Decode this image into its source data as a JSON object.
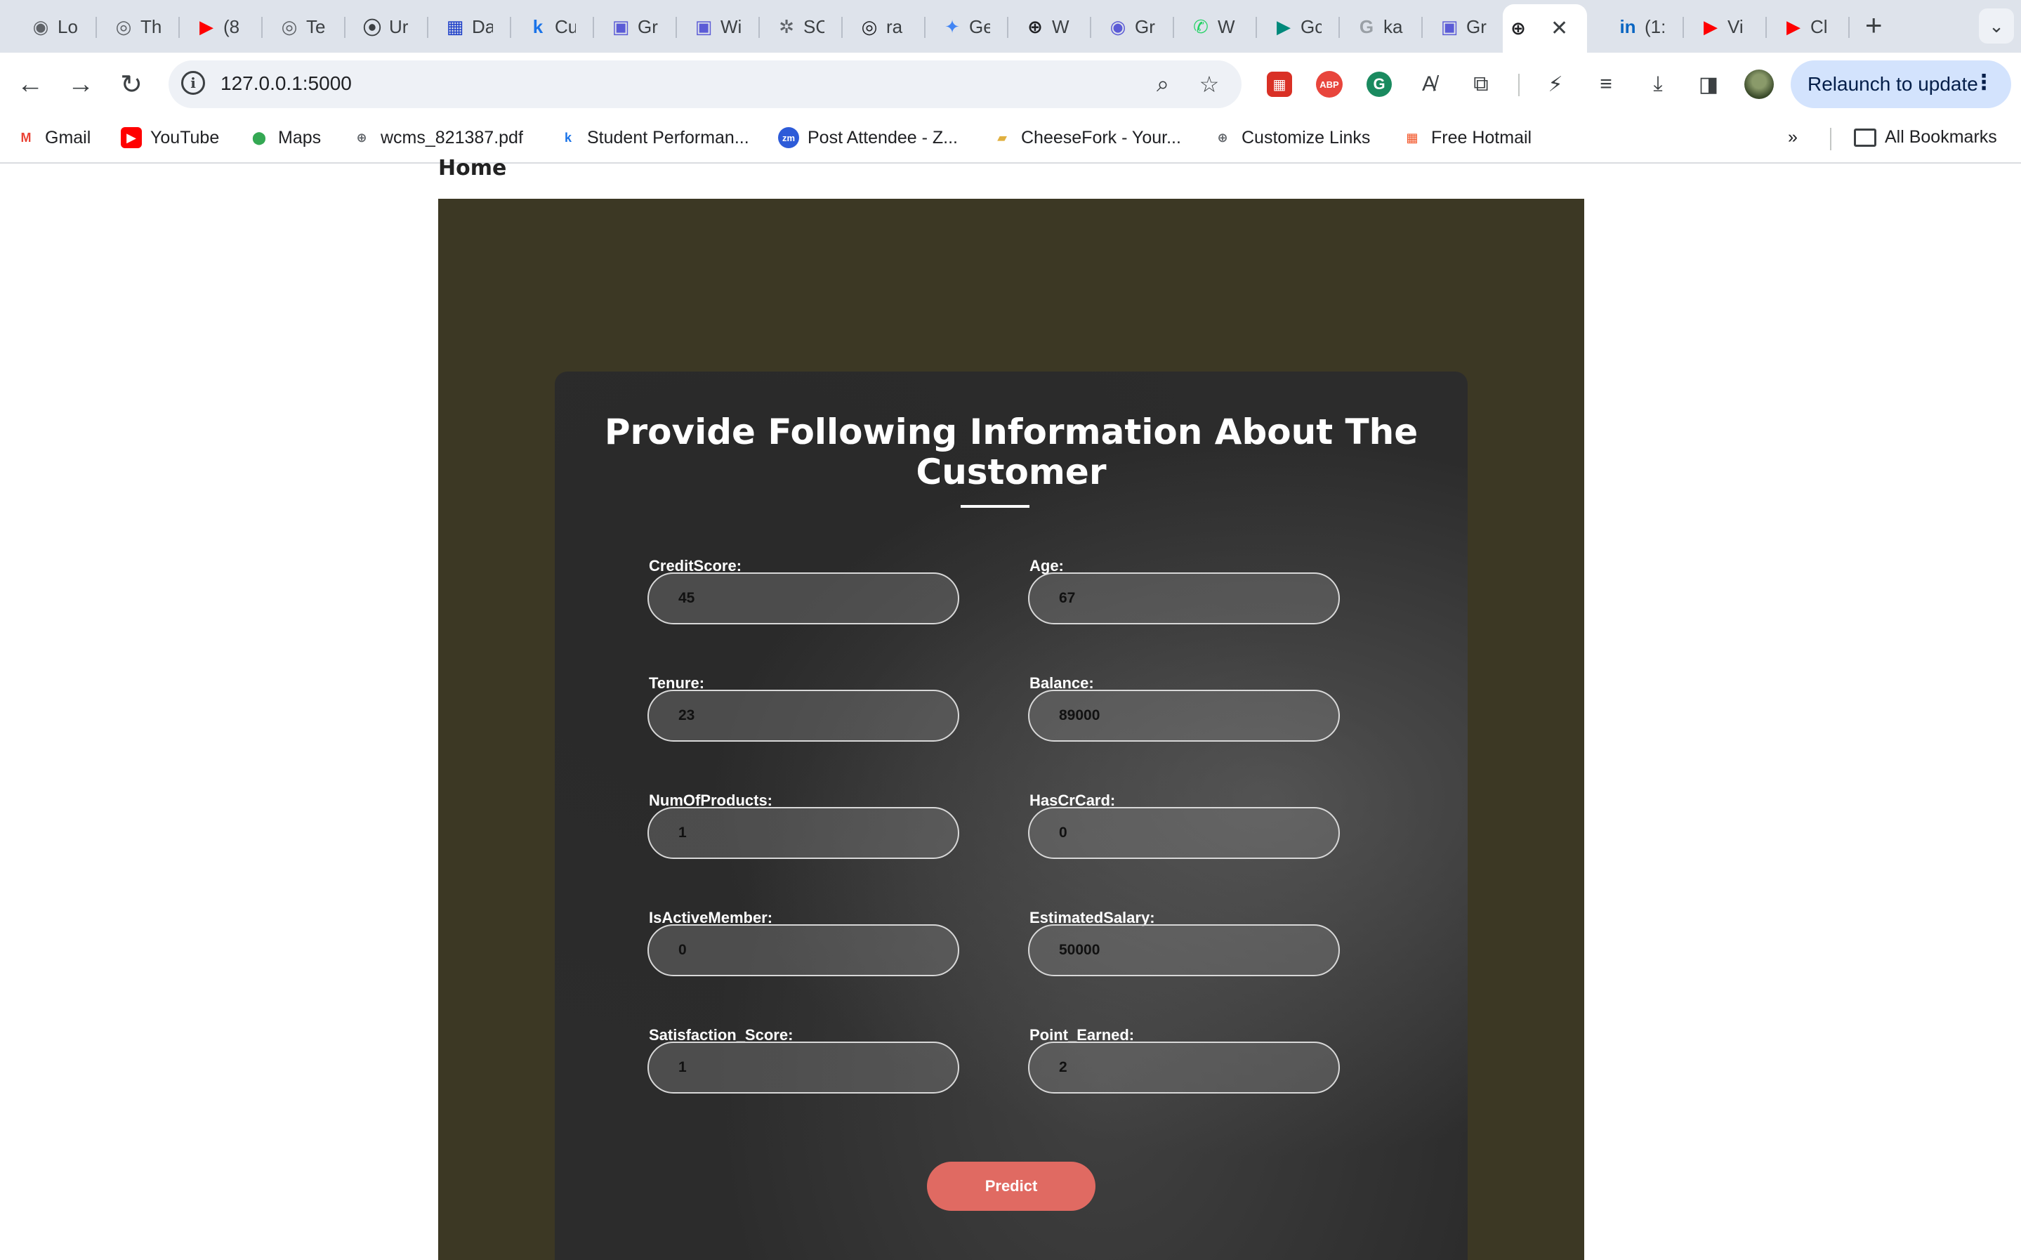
{
  "browser": {
    "tabs": [
      {
        "title": "Lo",
        "icon": "circle-icon",
        "color": "#5f6368"
      },
      {
        "title": "Th",
        "icon": "github-icon",
        "color": "#5f6368"
      },
      {
        "title": "(8",
        "icon": "youtube-icon",
        "color": "#ff0000"
      },
      {
        "title": "Te",
        "icon": "github-icon",
        "color": "#5f6368"
      },
      {
        "title": "Ur",
        "icon": "record-icon",
        "color": "#3c4043"
      },
      {
        "title": "Da",
        "icon": "grid-icon",
        "color": "#1a3cc8"
      },
      {
        "title": "Cu",
        "icon": "k-icon",
        "color": "#1a73e8"
      },
      {
        "title": "Gr",
        "icon": "printer-icon",
        "color": "#5b5bd6"
      },
      {
        "title": "Wi",
        "icon": "printer-icon",
        "color": "#5b5bd6"
      },
      {
        "title": "SC",
        "icon": "openai-icon",
        "color": "#5f6368"
      },
      {
        "title": "ra",
        "icon": "github-icon",
        "color": "#202124"
      },
      {
        "title": "Ge",
        "icon": "sparkle-icon",
        "color": "#4285f4"
      },
      {
        "title": "W",
        "icon": "globe-icon",
        "color": "#202124"
      },
      {
        "title": "Gr",
        "icon": "circle-icon",
        "color": "#5b5bd6"
      },
      {
        "title": "W",
        "icon": "whatsapp-icon",
        "color": "#25d366"
      },
      {
        "title": "Gc",
        "icon": "meet-icon",
        "color": "#00897b"
      },
      {
        "title": "ka",
        "icon": "google-icon",
        "color": "#9aa0a6"
      },
      {
        "title": "Gr",
        "icon": "printer-icon",
        "color": "#5b5bd6"
      },
      {
        "title": "",
        "icon": "globe-icon",
        "color": "#202124",
        "active": true
      },
      {
        "title": "(1:",
        "icon": "linkedin-icon",
        "color": "#0a66c2"
      },
      {
        "title": "Vi",
        "icon": "youtube-icon",
        "color": "#ff0000"
      },
      {
        "title": "Cl",
        "icon": "youtube-icon",
        "color": "#ff0000"
      }
    ],
    "url": "127.0.0.1:5000",
    "relaunch_label": "Relaunch to update",
    "bookmarks": [
      {
        "label": "Gmail",
        "icon": "gmail-icon"
      },
      {
        "label": "YouTube",
        "icon": "youtube-icon"
      },
      {
        "label": "Maps",
        "icon": "maps-icon"
      },
      {
        "label": "wcms_821387.pdf",
        "icon": "globe-icon"
      },
      {
        "label": "Student Performan...",
        "icon": "k-icon"
      },
      {
        "label": "Post Attendee - Z...",
        "icon": "zoom-icon"
      },
      {
        "label": "CheeseFork - Your...",
        "icon": "cheese-icon"
      },
      {
        "label": "Customize Links",
        "icon": "globe-icon"
      },
      {
        "label": "Free Hotmail",
        "icon": "windows-icon"
      }
    ],
    "all_bookmarks_label": "All Bookmarks"
  },
  "page": {
    "home_label": "Home",
    "title": "Provide Following Information About The Customer",
    "fields": [
      {
        "label": "CreditScore:",
        "value": "45"
      },
      {
        "label": "Age:",
        "value": "67"
      },
      {
        "label": "Tenure:",
        "value": "23"
      },
      {
        "label": "Balance:",
        "value": "89000"
      },
      {
        "label": "NumOfProducts:",
        "value": "1"
      },
      {
        "label": "HasCrCard:",
        "value": "0"
      },
      {
        "label": "IsActiveMember:",
        "value": "0"
      },
      {
        "label": "EstimatedSalary:",
        "value": "50000"
      },
      {
        "label": "Satisfaction_Score:",
        "value": "1"
      },
      {
        "label": "Point_Earned:",
        "value": "2"
      }
    ],
    "predict_label": "Predict"
  },
  "colors": {
    "page_background": "#3c3824",
    "card_background": "#2c2c2c",
    "predict_button": "#e06a62"
  }
}
